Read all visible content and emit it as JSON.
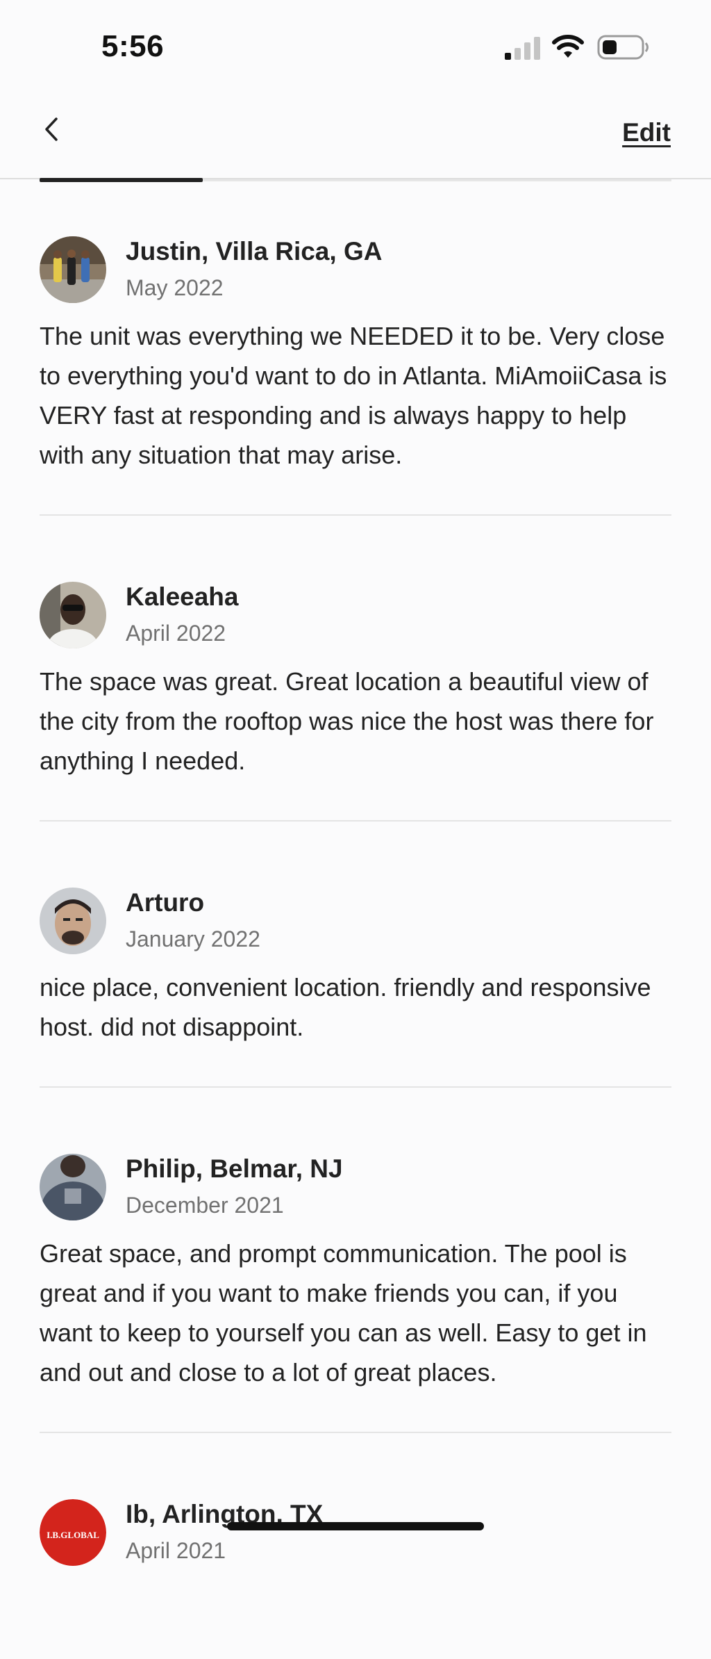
{
  "status_bar": {
    "time": "5:56"
  },
  "nav": {
    "edit_label": "Edit"
  },
  "reviews": [
    {
      "name": "Justin, Villa Rica, GA",
      "date": "May 2022",
      "text": "The unit was everything we NEEDED it to be. Very close to everything you'd want to do in Atlanta. MiAmoiiCasa is VERY fast at responding and is always happy to help with any situation that may arise."
    },
    {
      "name": "Kaleeaha",
      "date": "April 2022",
      "text": "The space was great. Great location a beautiful view of the city from the rooftop was nice the host was there for anything I needed."
    },
    {
      "name": "Arturo",
      "date": "January 2022",
      "text": "nice place, convenient location. friendly and responsive host. did not disappoint."
    },
    {
      "name": "Philip, Belmar, NJ",
      "date": "December 2021",
      "text": "Great space, and prompt communication. The pool is great and if you want to make friends you can, if you want to keep to yourself you can as well. Easy to get in and out and close to a lot of great places."
    },
    {
      "name": "Ib, Arlington, TX",
      "date": "April 2021",
      "text": ""
    }
  ],
  "avatar_logo_text": "I.B.GLOBAL",
  "colors": {
    "text_primary": "#222222",
    "text_secondary": "#717171",
    "divider": "#e4e4e4",
    "background": "#fbfbfc"
  }
}
